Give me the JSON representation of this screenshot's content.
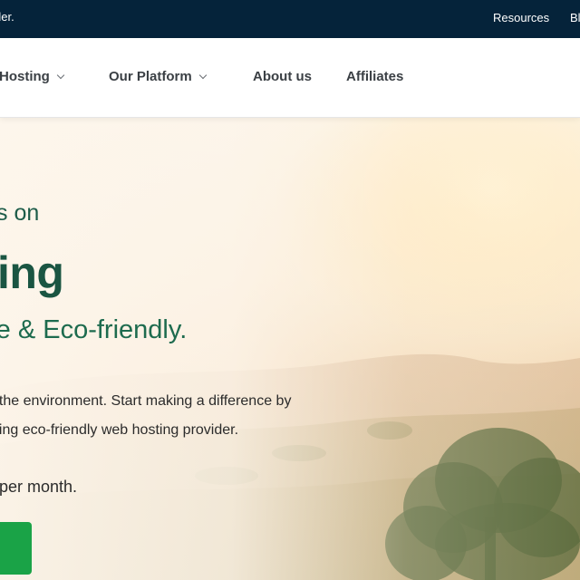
{
  "topbar": {
    "tagline": "der.",
    "links": [
      "Resources",
      "Bl"
    ]
  },
  "nav": {
    "items": [
      {
        "label": "Hosting",
        "has_dropdown": true
      },
      {
        "label": "Our Platform",
        "has_dropdown": true
      },
      {
        "label": "About us",
        "has_dropdown": false
      },
      {
        "label": "Affiliates",
        "has_dropdown": false
      }
    ]
  },
  "hero": {
    "eyebrow": "s on",
    "title": "ing",
    "subtitle": "re & Eco-friendly.",
    "description_lines": [
      "f the environment. Start making a difference by",
      "ding eco-friendly web hosting provider."
    ],
    "price_text": "per month.",
    "cta_label": ""
  },
  "colors": {
    "topbar_bg": "#05233a",
    "heading_green": "#1a5542",
    "cta_green": "#1aa347"
  },
  "icons": [
    "chevron-down-icon"
  ]
}
